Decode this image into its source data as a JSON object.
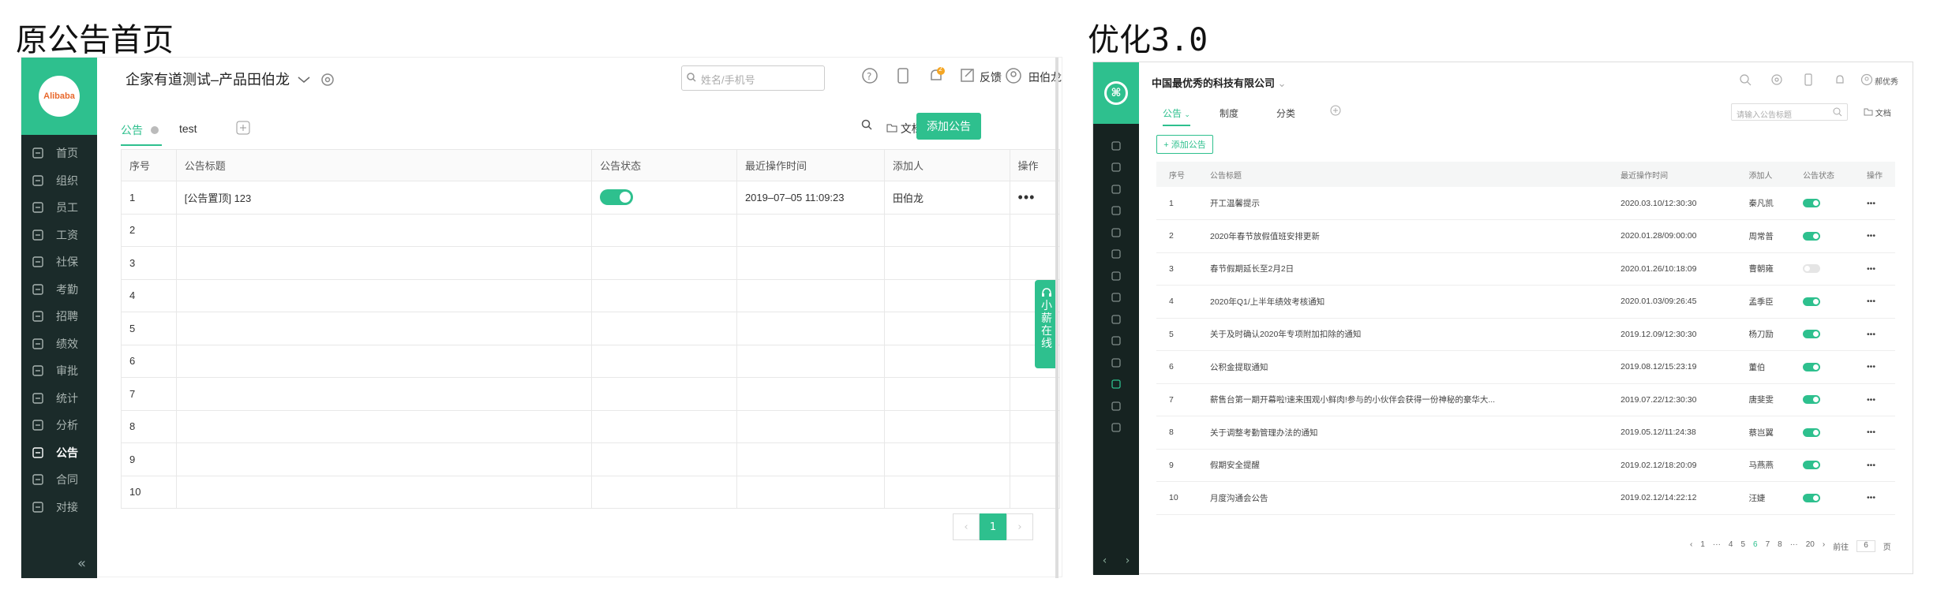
{
  "titles": {
    "original": "原公告首页",
    "optimized": "优化3.0"
  },
  "left": {
    "logo_text": "Alibaba",
    "nav": [
      {
        "label": "首页",
        "icon": "home-icon"
      },
      {
        "label": "组织",
        "icon": "org-icon"
      },
      {
        "label": "员工",
        "icon": "employee-icon"
      },
      {
        "label": "工资",
        "icon": "salary-icon"
      },
      {
        "label": "社保",
        "icon": "insurance-icon"
      },
      {
        "label": "考勤",
        "icon": "attendance-icon"
      },
      {
        "label": "招聘",
        "icon": "recruit-icon"
      },
      {
        "label": "绩效",
        "icon": "performance-icon"
      },
      {
        "label": "审批",
        "icon": "approval-icon"
      },
      {
        "label": "统计",
        "icon": "stats-icon"
      },
      {
        "label": "分析",
        "icon": "analysis-icon"
      },
      {
        "label": "公告",
        "icon": "notice-icon",
        "active": true
      },
      {
        "label": "合同",
        "icon": "contract-icon"
      },
      {
        "label": "对接",
        "icon": "connect-icon"
      }
    ],
    "collapse": "«",
    "company": "企家有道测试–产品田伯龙",
    "search_placeholder": "姓名/手机号",
    "badge": "2",
    "feedback": "反馈",
    "user": "田伯龙",
    "tabs": [
      "公告",
      "test"
    ],
    "doc_label": "文档",
    "add_button": "添加公告",
    "columns": [
      "序号",
      "公告标题",
      "公告状态",
      "最近操作时间",
      "添加人",
      "操作"
    ],
    "rows": [
      {
        "no": "1",
        "title": "[公告置顶] 123",
        "status": true,
        "time": "2019–07–05 11:09:23",
        "user": "田伯龙",
        "op": "•••"
      },
      {
        "no": "2",
        "title": "",
        "status": null,
        "time": "",
        "user": "",
        "op": ""
      },
      {
        "no": "3",
        "title": "",
        "status": null,
        "time": "",
        "user": "",
        "op": ""
      },
      {
        "no": "4",
        "title": "",
        "status": null,
        "time": "",
        "user": "",
        "op": ""
      },
      {
        "no": "5",
        "title": "",
        "status": null,
        "time": "",
        "user": "",
        "op": ""
      },
      {
        "no": "6",
        "title": "",
        "status": null,
        "time": "",
        "user": "",
        "op": ""
      },
      {
        "no": "7",
        "title": "",
        "status": null,
        "time": "",
        "user": "",
        "op": ""
      },
      {
        "no": "8",
        "title": "",
        "status": null,
        "time": "",
        "user": "",
        "op": ""
      },
      {
        "no": "9",
        "title": "",
        "status": null,
        "time": "",
        "user": "",
        "op": ""
      },
      {
        "no": "10",
        "title": "",
        "status": null,
        "time": "",
        "user": "",
        "op": ""
      }
    ],
    "pager": {
      "prev": "‹",
      "current": "1",
      "next": "›"
    },
    "float_chars": [
      "小",
      "薪",
      "在",
      "线"
    ]
  },
  "right": {
    "company": "中国最优秀的科技有限公司",
    "user": "郝优秀",
    "tabs": [
      "公告",
      "制度",
      "分类"
    ],
    "search_placeholder": "请输入公告标题",
    "doc_label": "文档",
    "add_button": "+ 添加公告",
    "columns": [
      "序号",
      "公告标题",
      "最近操作时间",
      "添加人",
      "公告状态",
      "操作"
    ],
    "rows": [
      {
        "no": "1",
        "title": "开工温馨提示",
        "time": "2020.03.10/12:30:30",
        "user": "秦凡凯",
        "status": true,
        "op": "•••"
      },
      {
        "no": "2",
        "title": "2020年春节放假值班安排更新",
        "time": "2020.01.28/09:00:00",
        "user": "周常普",
        "status": true,
        "op": "•••"
      },
      {
        "no": "3",
        "title": "春节假期延长至2月2日",
        "time": "2020.01.26/10:18:09",
        "user": "曹朝雍",
        "status": false,
        "op": "•••"
      },
      {
        "no": "4",
        "title": "2020年Q1/上半年绩效考核通知",
        "time": "2020.01.03/09:26:45",
        "user": "孟季臣",
        "status": true,
        "op": "•••"
      },
      {
        "no": "5",
        "title": "关于及时确认2020年专项附加扣除的通知",
        "time": "2019.12.09/12:30:30",
        "user": "杨刀励",
        "status": true,
        "op": "•••"
      },
      {
        "no": "6",
        "title": "公积金提取通知",
        "time": "2019.08.12/15:23:19",
        "user": "董伯",
        "status": true,
        "op": "•••"
      },
      {
        "no": "7",
        "title": "薪售台第一期开幕啦!速来围观小鲜肉!参与的小伙伴会获得一份神秘的豪华大...",
        "time": "2019.07.22/12:30:30",
        "user": "唐斐雯",
        "status": true,
        "op": "•••"
      },
      {
        "no": "8",
        "title": "关于调整考勤管理办法的通知",
        "time": "2019.05.12/11:24:38",
        "user": "蔡岂翼",
        "status": true,
        "op": "•••"
      },
      {
        "no": "9",
        "title": "假期安全提醒",
        "time": "2019.02.12/18:20:09",
        "user": "马燕燕",
        "status": true,
        "op": "•••"
      },
      {
        "no": "10",
        "title": "月度沟通会公告",
        "time": "2019.02.12/14:22:12",
        "user": "汪婕",
        "status": true,
        "op": "•••"
      }
    ],
    "pager": [
      "‹",
      "1",
      "···",
      "4",
      "5",
      "6",
      "7",
      "8",
      "···",
      "20",
      "›",
      "前往",
      "6",
      "页"
    ],
    "pager_current": "6",
    "arrows": [
      "‹",
      "›"
    ]
  },
  "colors": {
    "accent": "#2ec08e",
    "sidebar": "#1b2b2a"
  }
}
